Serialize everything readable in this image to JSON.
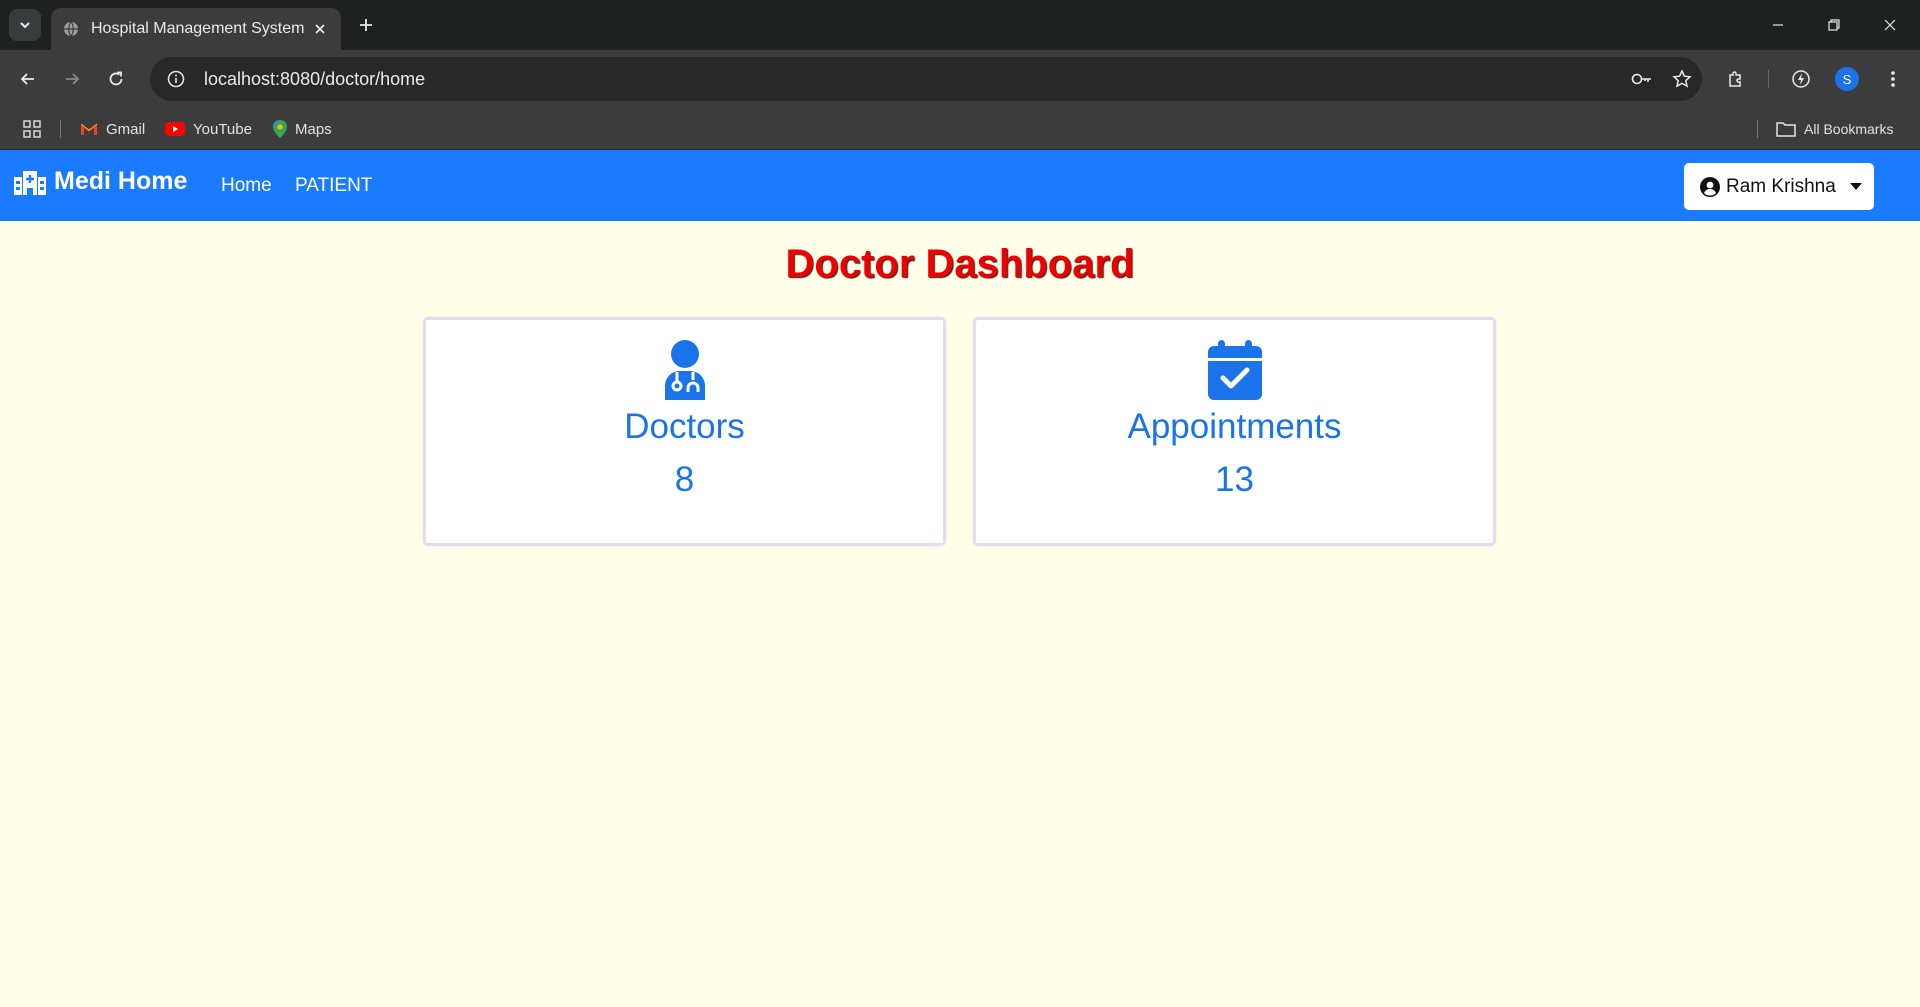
{
  "browser": {
    "tab_title": "Hospital Management System",
    "url": "localhost:8080/doctor/home",
    "bookmarks": [
      {
        "label": "Gmail",
        "icon": "gmail-icon"
      },
      {
        "label": "YouTube",
        "icon": "youtube-icon"
      },
      {
        "label": "Maps",
        "icon": "maps-icon"
      }
    ],
    "all_bookmarks_label": "All Bookmarks",
    "profile_initial": "S"
  },
  "navbar": {
    "brand": "Medi Home",
    "links": [
      "Home",
      "PATIENT"
    ],
    "user": "Ram Krishna",
    "color": "#1a7bff"
  },
  "main": {
    "title": "Doctor Dashboard",
    "cards": [
      {
        "label": "Doctors",
        "value": "8",
        "icon": "doctor-icon"
      },
      {
        "label": "Appointments",
        "value": "13",
        "icon": "calendar-check-icon"
      }
    ],
    "accent": "#1a73e8",
    "title_color": "#ee0000",
    "background": "#fffee9"
  }
}
